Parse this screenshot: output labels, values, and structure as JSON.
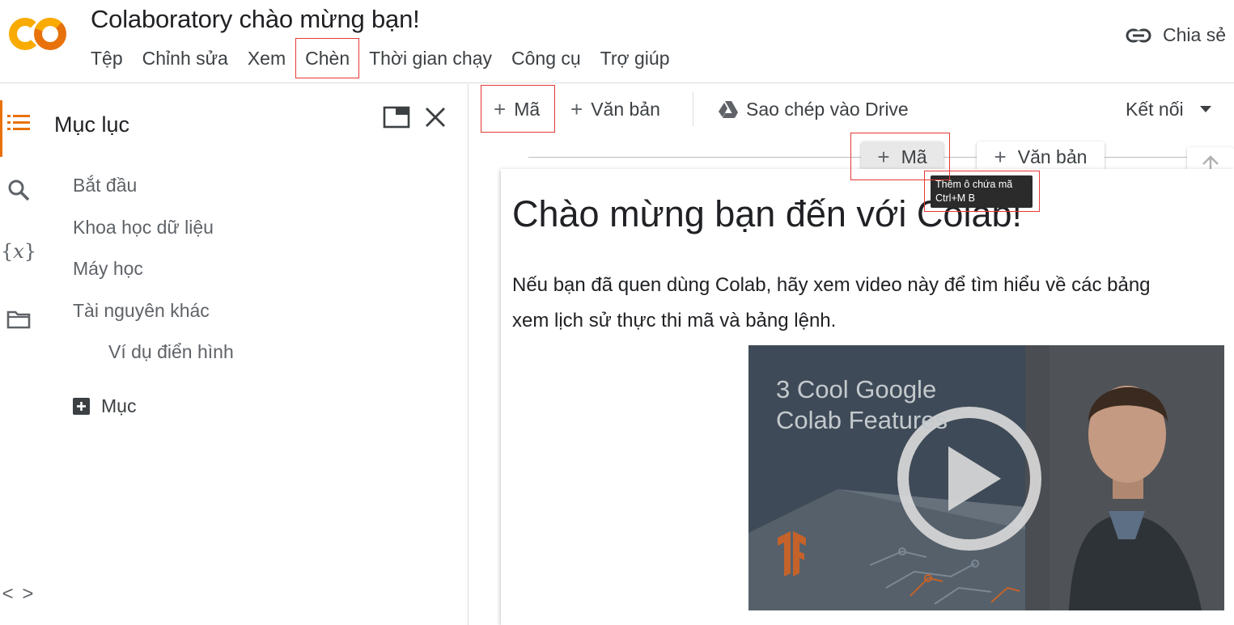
{
  "header": {
    "logo_text": "CO",
    "title": "Colaboratory chào mừng bạn!",
    "share_label": "Chia sẻ",
    "menu": [
      {
        "label": "Tệp"
      },
      {
        "label": "Chỉnh sửa"
      },
      {
        "label": "Xem"
      },
      {
        "label": "Chèn",
        "highlighted": true
      },
      {
        "label": "Thời gian chạy"
      },
      {
        "label": "Công cụ"
      },
      {
        "label": "Trợ giúp"
      }
    ]
  },
  "iconbar": {
    "icons": [
      "toc-icon",
      "search-icon",
      "variables-icon",
      "folder-icon",
      "code-snippets-icon"
    ],
    "variables_glyph": "{𝑥}",
    "code_glyph": "< >"
  },
  "sidebar": {
    "title": "Mục lục",
    "items": [
      {
        "label": "Bắt đầu",
        "level": 1
      },
      {
        "label": "Khoa học dữ liệu",
        "level": 1
      },
      {
        "label": "Máy học",
        "level": 1
      },
      {
        "label": "Tài nguyên khác",
        "level": 1
      },
      {
        "label": "Ví dụ điển hình",
        "level": 2
      }
    ],
    "add_section_label": "Mục"
  },
  "toolbar": {
    "add_code_label": "Mã",
    "add_text_label": "Văn bản",
    "copy_to_drive_label": "Sao chép vào Drive",
    "connect_label": "Kết nối"
  },
  "insert_bar": {
    "code_label": "Mã",
    "text_label": "Văn bản"
  },
  "tooltip": {
    "line1": "Thêm ô chứa mã",
    "line2": "Ctrl+M B"
  },
  "cell": {
    "heading": "Chào mừng bạn đến với Colab!",
    "paragraph_line1": "Nếu bạn đã quen dùng Colab, hãy xem video này để tìm hiểu về các bảng",
    "paragraph_line2": "xem lịch sử thực thi mã và bảng lệnh.",
    "video_title": "3 Cool Google\nColab Features"
  },
  "colors": {
    "accent_orange": "#e8710a",
    "logo_yellow": "#f9ab00",
    "highlight_red": "#e53935"
  }
}
